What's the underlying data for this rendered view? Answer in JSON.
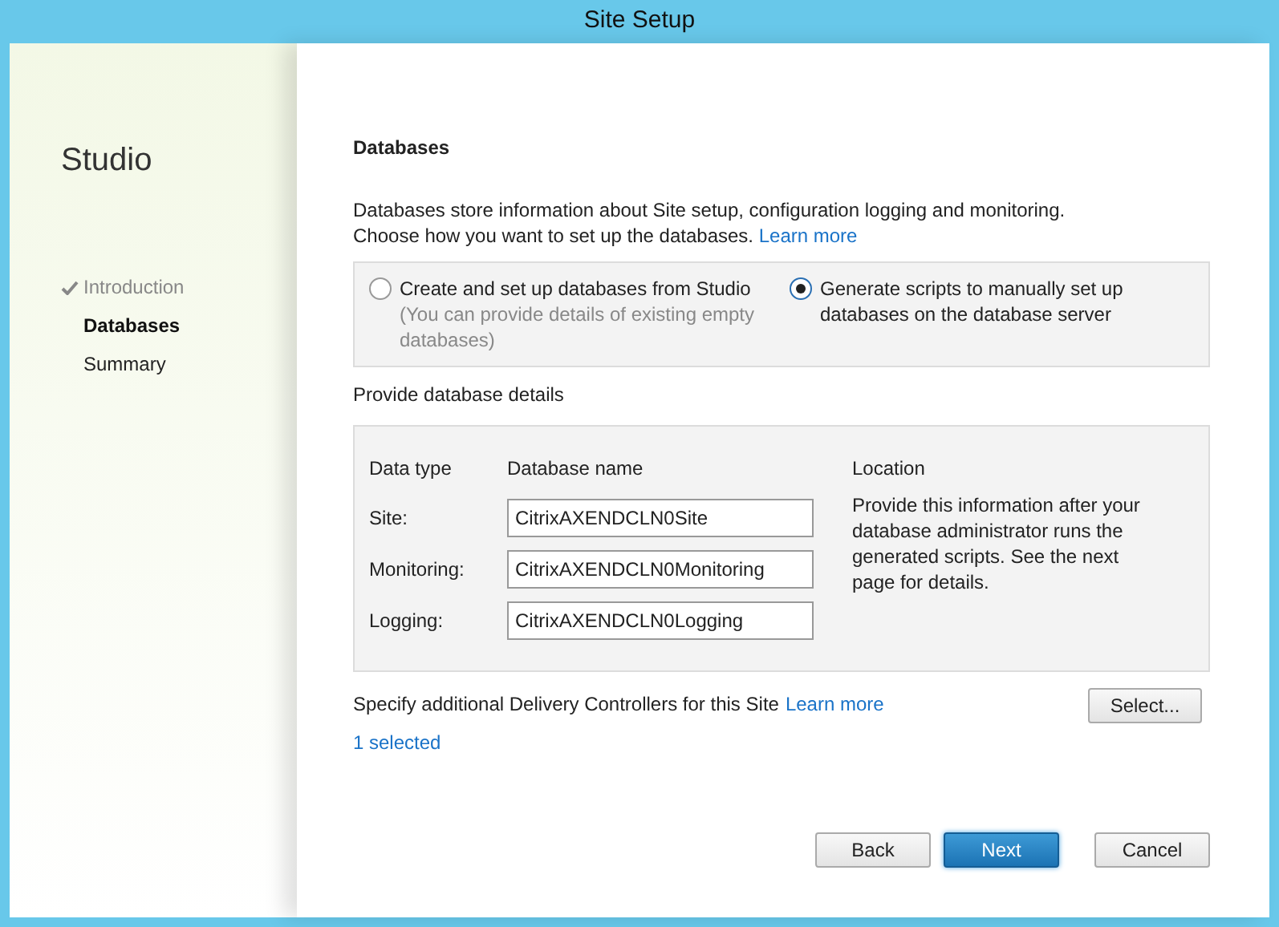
{
  "window": {
    "title": "Site Setup"
  },
  "sidebar": {
    "title": "Studio",
    "steps": [
      {
        "label": "Introduction",
        "done": true,
        "selected": false
      },
      {
        "label": "Databases",
        "done": false,
        "selected": true
      },
      {
        "label": "Summary",
        "done": false,
        "selected": false
      }
    ]
  },
  "page": {
    "heading": "Databases",
    "intro": "Databases store information about Site setup, configuration logging and monitoring. Choose how you want to set up the databases.",
    "intro_link": "Learn more",
    "options": [
      {
        "label": "Create and set up databases from Studio",
        "note": "(You can provide details of existing empty databases)",
        "selected": false
      },
      {
        "label": "Generate scripts to manually set up databases on the database server",
        "selected": true
      }
    ],
    "details_label": "Provide database details",
    "columns": [
      "Data type",
      "Database name",
      "Location"
    ],
    "rows": [
      {
        "type": "Site:",
        "value": "CitrixAXENDCLN0Site"
      },
      {
        "type": "Monitoring:",
        "value": "CitrixAXENDCLN0Monitoring"
      },
      {
        "type": "Logging:",
        "value": "CitrixAXENDCLN0Logging"
      }
    ],
    "location_note": "Provide this information after your database administrator runs the generated scripts. See the next page for details.",
    "controllers_label": "Specify additional Delivery Controllers for this Site",
    "controllers_link": "Learn more",
    "select_button": "Select...",
    "selected_count": "1 selected"
  },
  "buttons": [
    {
      "label": "Back",
      "primary": false
    },
    {
      "label": "Next",
      "primary": true
    },
    {
      "label": "Cancel",
      "primary": false
    }
  ]
}
